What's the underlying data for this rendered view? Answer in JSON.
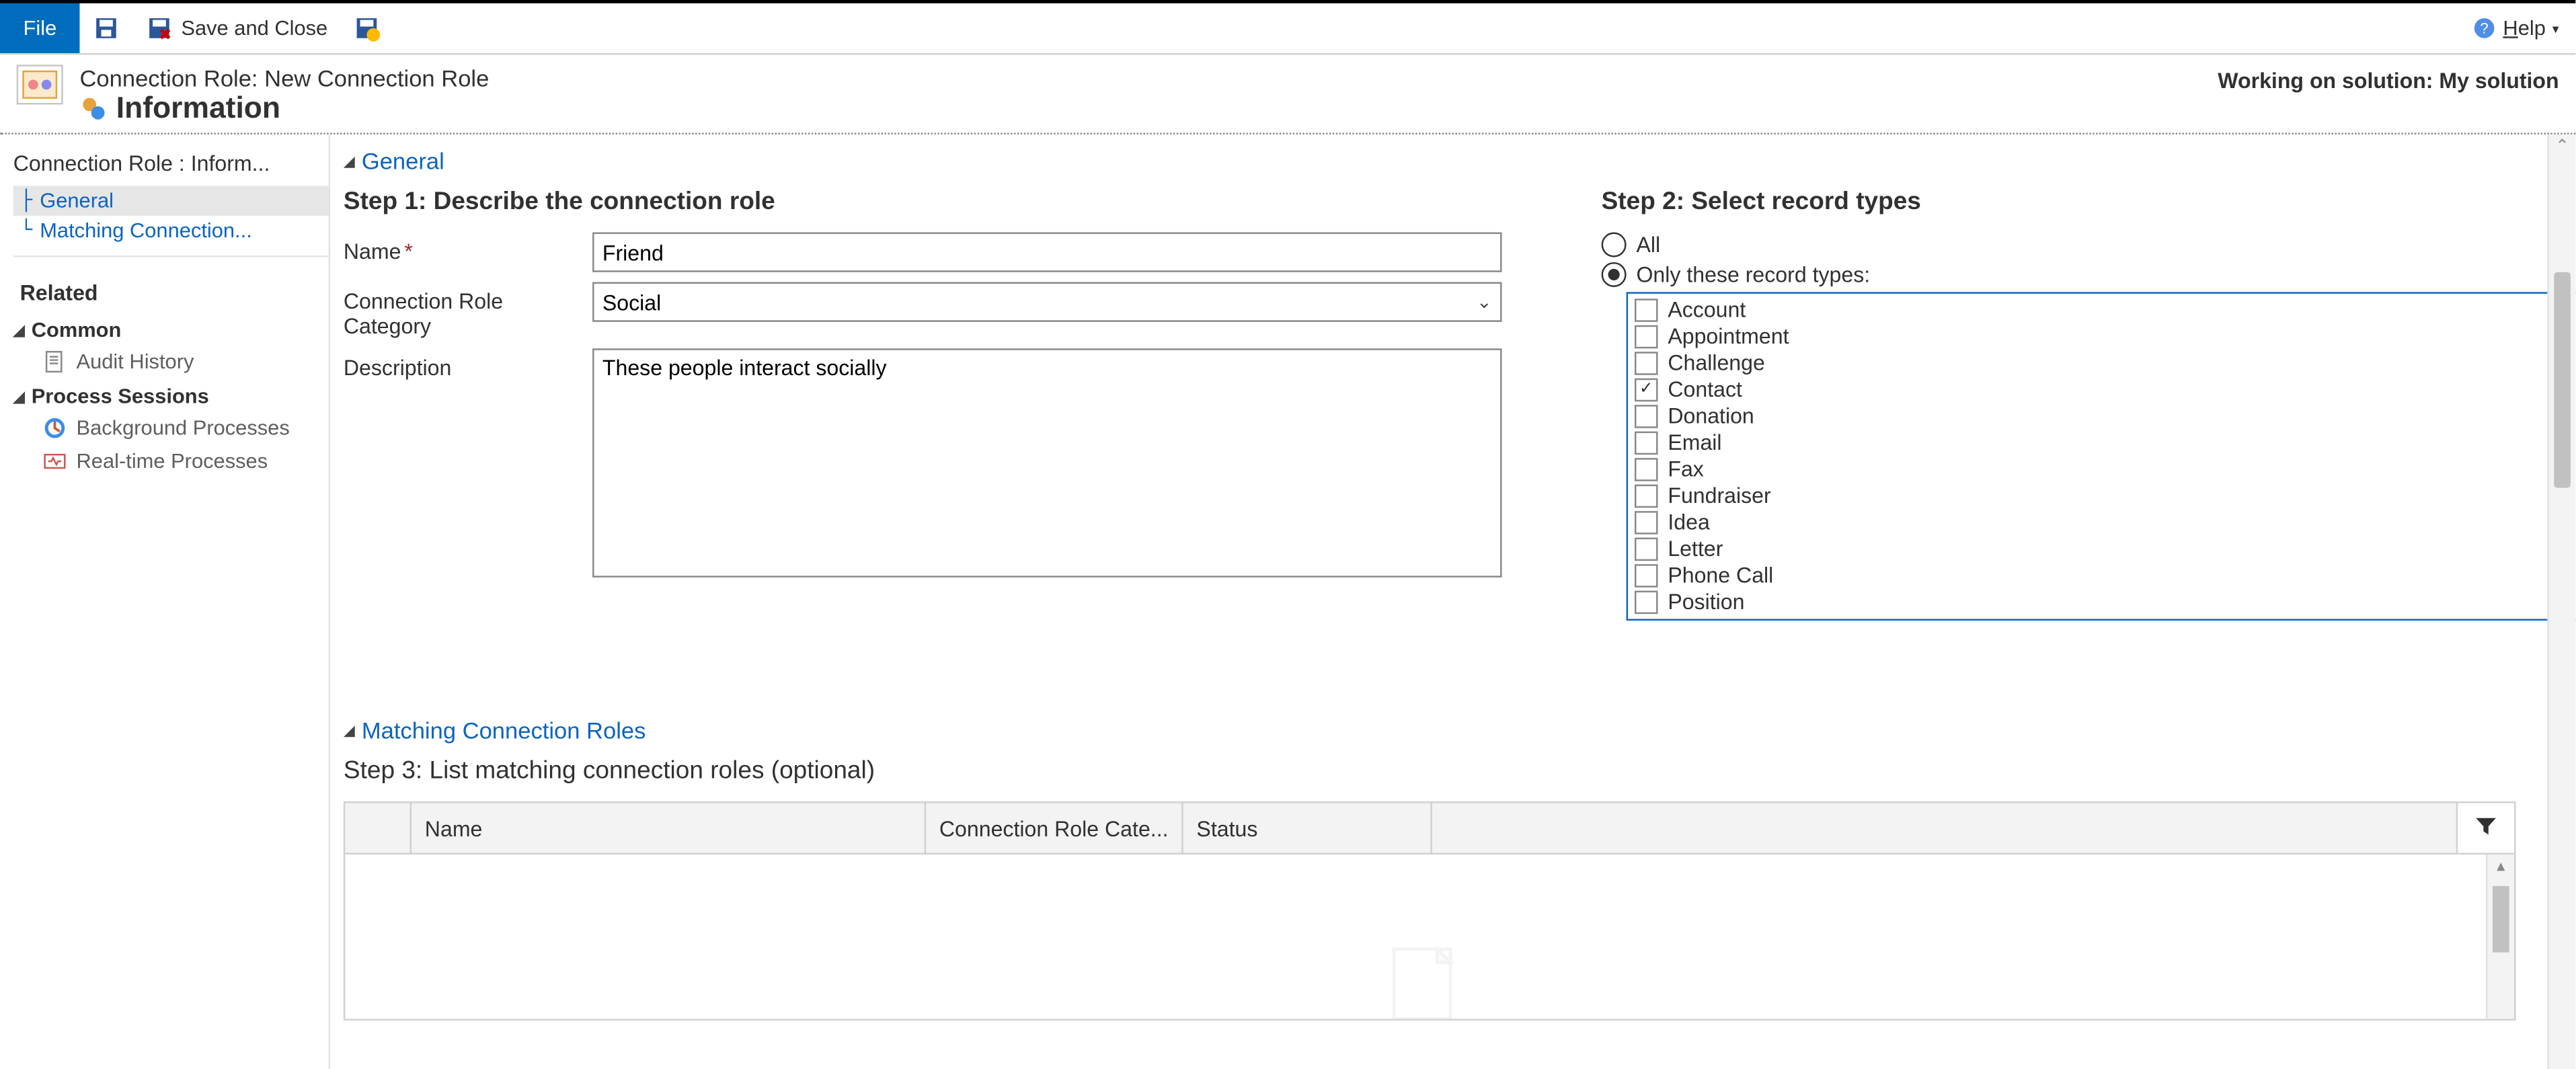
{
  "ribbon": {
    "file_label": "File",
    "save_close_label": "Save and Close",
    "help_label_prefix": "H",
    "help_label_rest": "elp"
  },
  "header": {
    "breadcrumb": "Connection Role: New Connection Role",
    "title": "Information",
    "solution": "Working on solution: My solution"
  },
  "sidebar": {
    "title": "Connection Role : Inform...",
    "tree": [
      {
        "label": "General",
        "active": true
      },
      {
        "label": "Matching Connection...",
        "active": false
      }
    ],
    "related_label": "Related",
    "common": {
      "label": "Common",
      "items": [
        {
          "label": "Audit History"
        }
      ]
    },
    "process_sessions": {
      "label": "Process Sessions",
      "items": [
        {
          "label": "Background Processes"
        },
        {
          "label": "Real-time Processes"
        }
      ]
    }
  },
  "sections": {
    "general": "General",
    "matching": "Matching Connection Roles"
  },
  "step1": {
    "heading": "Step 1: Describe the connection role",
    "name_label": "Name",
    "name_value": "Friend",
    "category_label": "Connection Role Category",
    "category_value": "Social",
    "description_label": "Description",
    "description_value": "These people interact socially"
  },
  "step2": {
    "heading": "Step 2: Select record types",
    "radio_all": "All",
    "radio_only": "Only these record types:",
    "selected_radio": "only",
    "records": [
      {
        "label": "Account",
        "checked": false
      },
      {
        "label": "Appointment",
        "checked": false
      },
      {
        "label": "Challenge",
        "checked": false
      },
      {
        "label": "Contact",
        "checked": true
      },
      {
        "label": "Donation",
        "checked": false
      },
      {
        "label": "Email",
        "checked": false
      },
      {
        "label": "Fax",
        "checked": false
      },
      {
        "label": "Fundraiser",
        "checked": false
      },
      {
        "label": "Idea",
        "checked": false
      },
      {
        "label": "Letter",
        "checked": false
      },
      {
        "label": "Phone Call",
        "checked": false
      },
      {
        "label": "Position",
        "checked": false
      }
    ]
  },
  "step3": {
    "heading": "Step 3: List matching connection roles (optional)",
    "columns": {
      "name": "Name",
      "category": "Connection Role Cate...",
      "status": "Status"
    }
  }
}
